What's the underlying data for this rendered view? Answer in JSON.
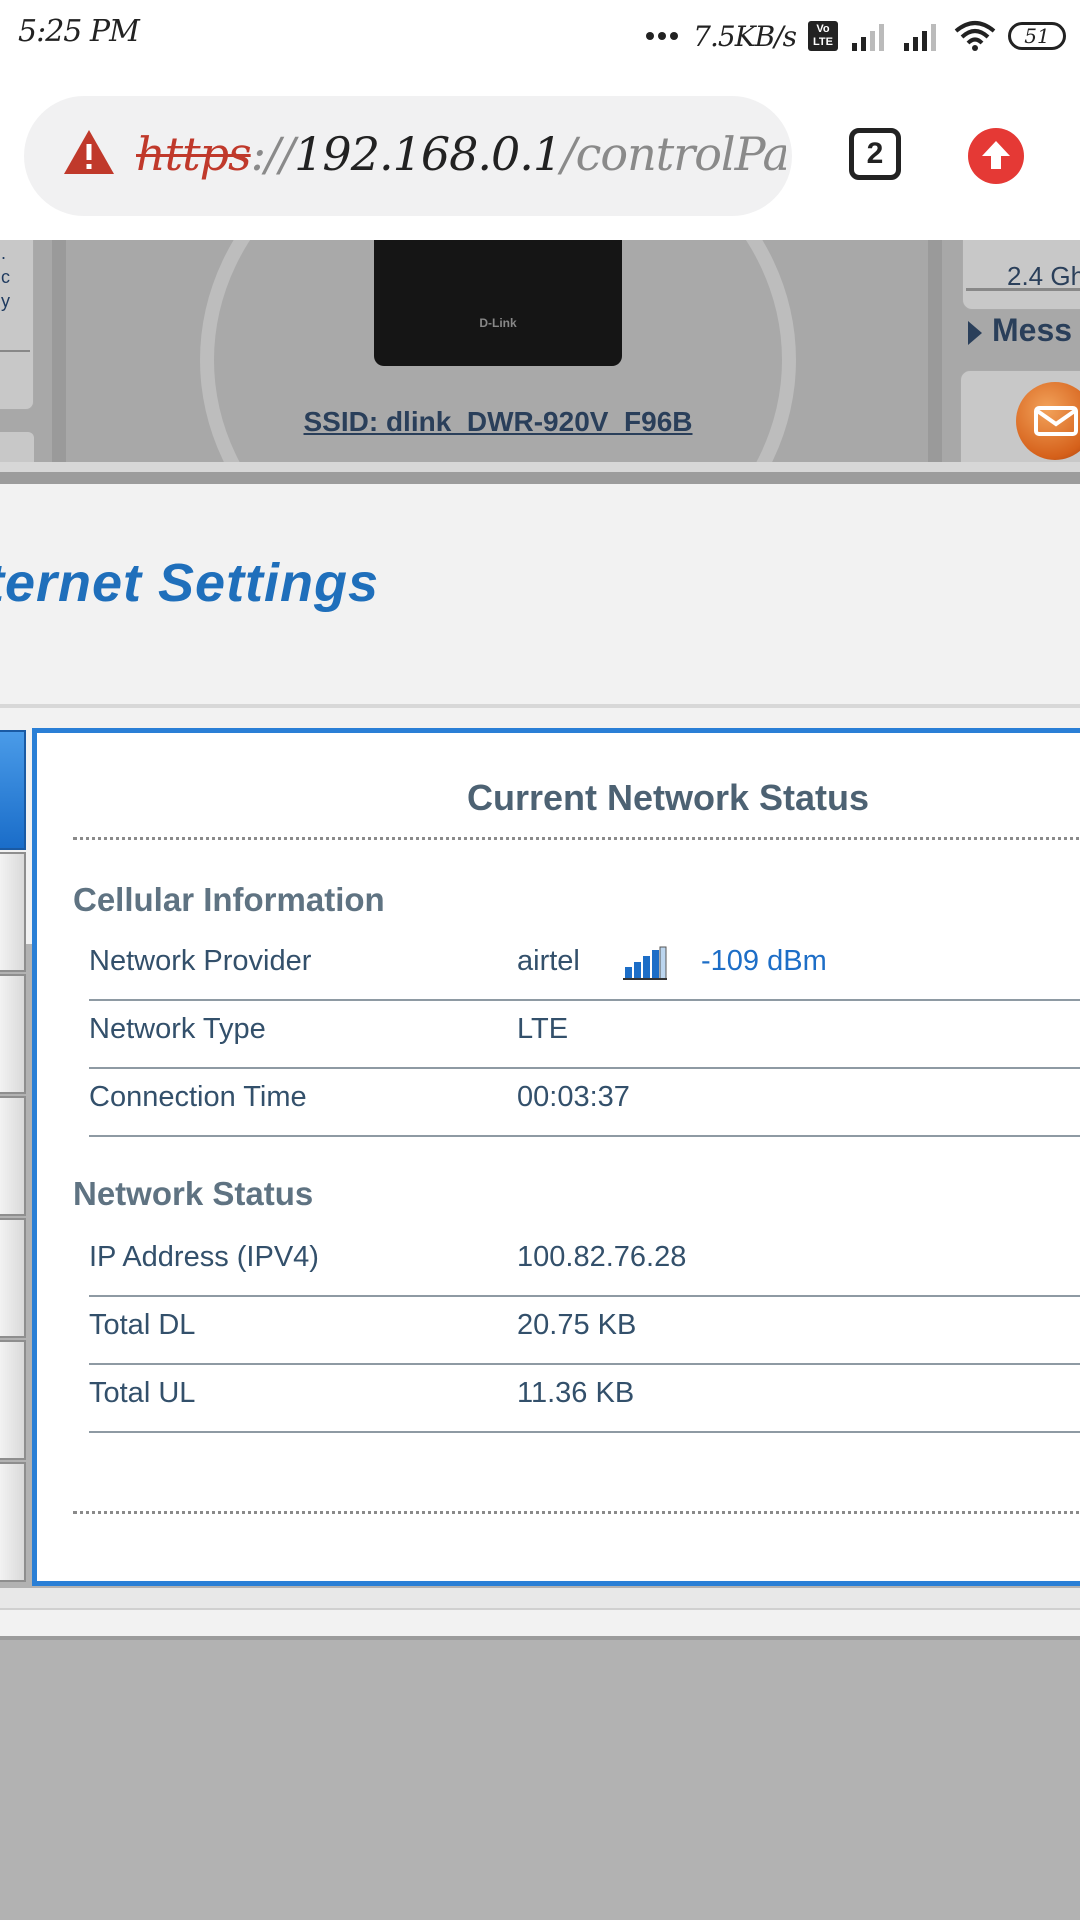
{
  "status_bar": {
    "time": "5:25 PM",
    "speed": "7.5KB/s",
    "volte": "Vo LTE",
    "battery": "51"
  },
  "browser": {
    "url_scheme": "https",
    "url_sep": "://",
    "url_host": "192.168.0.1",
    "url_path": "/controlPanel.h",
    "tab_count": "2"
  },
  "banner": {
    "ssid": "SSID: dlink_DWR-920V_F96B",
    "router_logo": "D-Link",
    "left_panel_text": [
      ".",
      "c",
      "y"
    ],
    "right_panel_text": "2.4 Gh",
    "messages_label": "Mess"
  },
  "page": {
    "title": "Internet Settings"
  },
  "network_status": {
    "card_title": "Current Network Status",
    "cellular": {
      "heading": "Cellular Information",
      "rows": [
        {
          "label": "Network Provider",
          "value": "airtel",
          "signal": "-109 dBm"
        },
        {
          "label": "Network Type",
          "value": "LTE"
        },
        {
          "label": "Connection Time",
          "value": "00:03:37"
        }
      ]
    },
    "network": {
      "heading": "Network Status",
      "rows": [
        {
          "label": "IP Address (IPV4)",
          "value": "100.82.76.28"
        },
        {
          "label": "Total DL",
          "value": "20.75 KB"
        },
        {
          "label": "Total UL",
          "value": "11.36 KB"
        }
      ]
    }
  },
  "colors": {
    "accent_blue": "#2a7fd6",
    "title_blue": "#1f6fbb",
    "warning_red": "#c0392b",
    "update_red": "#e53935"
  },
  "icons": {
    "warning": "warning-triangle-icon",
    "update": "arrow-up-icon",
    "signal": "signal-bars-icon",
    "wifi": "wifi-icon",
    "mail": "mail-icon"
  }
}
